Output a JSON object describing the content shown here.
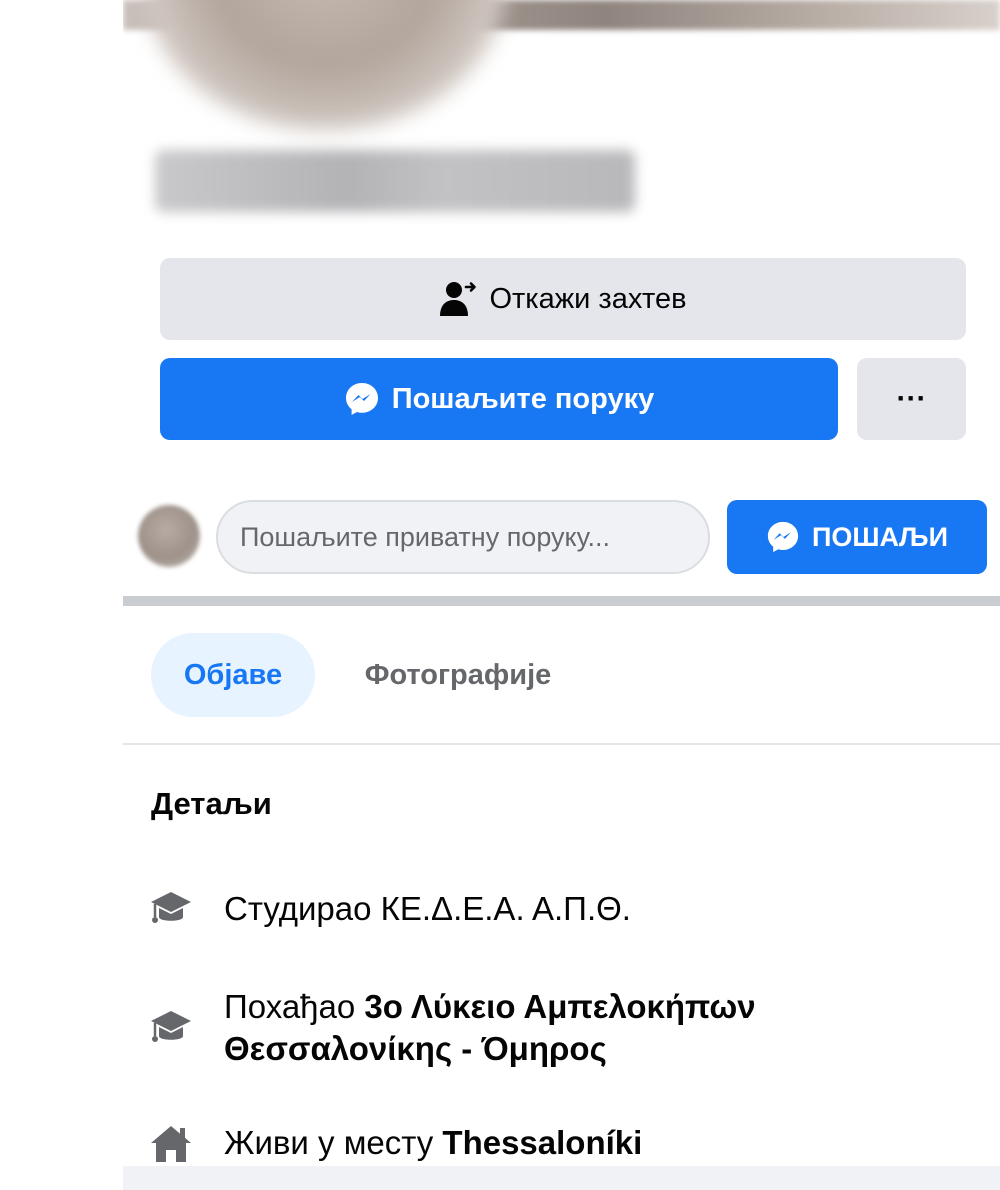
{
  "actions": {
    "cancel_request": "Откажи захтев",
    "send_message": "Пошаљите поруку",
    "more": "···"
  },
  "composer": {
    "placeholder": "Пошаљите приватну поруку...",
    "send_label": "ПОШАЉИ"
  },
  "tabs": [
    {
      "label": "Објаве",
      "active": true
    },
    {
      "label": "Фотографије",
      "active": false
    }
  ],
  "details": {
    "title": "Детаљи",
    "items": [
      {
        "icon": "graduation-cap-icon",
        "prefix": "Студирао КЕ.Δ.Ε.Α. Α.Π.Θ.",
        "bold": ""
      },
      {
        "icon": "graduation-cap-icon",
        "prefix": "Похађао ",
        "bold": "3ο Λύκειο Αμπελοκήπων Θεσσαλονίκης - Όμηρος"
      },
      {
        "icon": "home-icon",
        "prefix": "Живи у месту ",
        "bold": "Thessaloníki"
      }
    ]
  },
  "colors": {
    "primary_blue": "#1877f2",
    "button_gray": "#e4e6eb",
    "active_tab_bg": "#e7f3ff",
    "secondary_text": "#65676b"
  }
}
